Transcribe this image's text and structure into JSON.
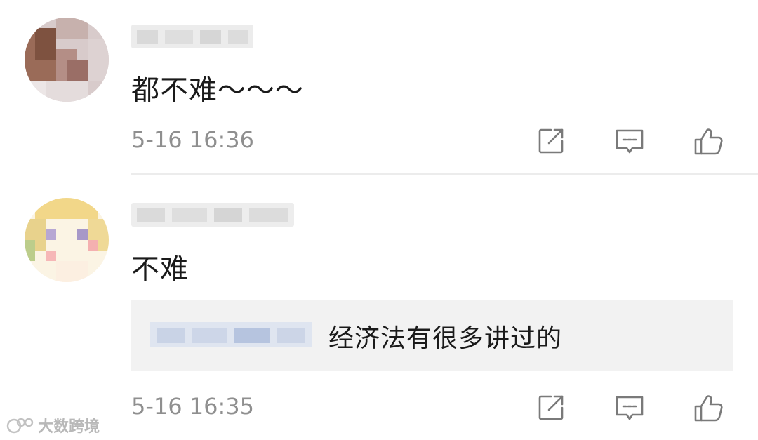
{
  "comments": [
    {
      "avatar_icon": "blurred-avatar-photo",
      "username_hidden": true,
      "text": "都不难～～～",
      "timestamp": "5-16 16:36"
    },
    {
      "avatar_icon": "blurred-avatar-anime",
      "username_hidden": true,
      "text": "不难",
      "quote": {
        "username_hidden": true,
        "text": "经济法有很多讲过的"
      },
      "timestamp": "5-16 16:35"
    }
  ],
  "actions": {
    "share_icon": "share-icon",
    "reply_icon": "reply-icon",
    "like_icon": "thumbs-up-icon"
  },
  "watermark": {
    "text": "大数跨境"
  },
  "colors": {
    "text": "#1a1a1a",
    "meta": "#8f8f8f",
    "icon": "#7a7a7a",
    "quote_bg": "#f2f2f2",
    "divider": "#ececec"
  }
}
